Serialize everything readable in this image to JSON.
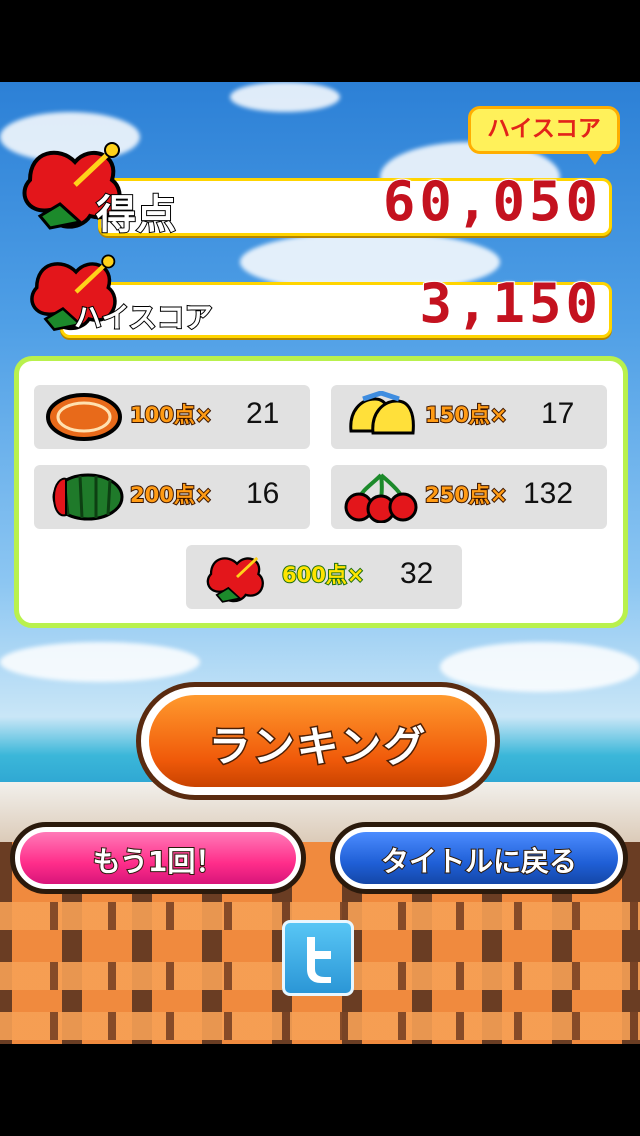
{
  "score": {
    "label": "得点",
    "value": "60,050"
  },
  "new_highscore_badge": "ハイスコア",
  "highscore": {
    "label": "ハイスコア",
    "value": "3,150"
  },
  "items": [
    {
      "name": "coin",
      "points": "100点×",
      "count": "21",
      "icon": "coin-icon"
    },
    {
      "name": "bell",
      "points": "150点×",
      "count": "17",
      "icon": "bell-icon"
    },
    {
      "name": "watermelon",
      "points": "200点×",
      "count": "16",
      "icon": "watermelon-icon"
    },
    {
      "name": "cherry",
      "points": "250点×",
      "count": "132",
      "icon": "cherry-icon"
    },
    {
      "name": "hibiscus",
      "points": "600点×",
      "count": "32",
      "icon": "hibiscus-icon"
    }
  ],
  "buttons": {
    "ranking": "ランキング",
    "retry": "もう1回！",
    "back_to_title": "タイトルに戻る"
  },
  "colors": {
    "score_red": "#c4121f",
    "panel_border": "#b9f14d",
    "ranking_orange": "#f05a0a",
    "retry_pink": "#ff2d8a",
    "title_blue": "#1f5fd6"
  }
}
